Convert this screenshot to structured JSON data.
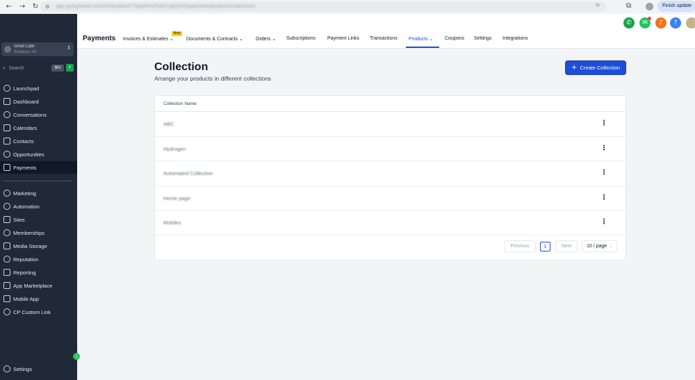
{
  "browser": {
    "url": "app.gohighlevel.com/v2/location/C7qIaeKm2hqEmvgQoD2/payments/products/collections",
    "finish_update": "Finish update"
  },
  "sidebar": {
    "account_name": "Small Cafe",
    "account_sub": "Bengaluru, KA",
    "search_placeholder": "Search",
    "search_shortcut": "⌘K",
    "items": [
      {
        "label": "Launchpad"
      },
      {
        "label": "Dashboard"
      },
      {
        "label": "Conversations"
      },
      {
        "label": "Calendars"
      },
      {
        "label": "Contacts"
      },
      {
        "label": "Opportunities"
      },
      {
        "label": "Payments"
      },
      {
        "label": "Marketing"
      },
      {
        "label": "Automation"
      },
      {
        "label": "Sites"
      },
      {
        "label": "Memberships"
      },
      {
        "label": "Media Storage"
      },
      {
        "label": "Reputation"
      },
      {
        "label": "Reporting"
      },
      {
        "label": "App Marketplace"
      },
      {
        "label": "Mobile App"
      },
      {
        "label": "CP Custom Link"
      }
    ],
    "settings": "Settings"
  },
  "header": {
    "title": "Payments",
    "new_badge": "New",
    "tabs": [
      {
        "label": "Invoices & Estimates ⌄"
      },
      {
        "label": "Documents & Contracts ⌄"
      },
      {
        "label": "Orders ⌄"
      },
      {
        "label": "Subscriptions"
      },
      {
        "label": "Payment Links"
      },
      {
        "label": "Transactions"
      },
      {
        "label": "Products ⌄"
      },
      {
        "label": "Coupons"
      },
      {
        "label": "Settings"
      },
      {
        "label": "Integrations"
      }
    ],
    "active_tab": "Products",
    "icon_colors": {
      "phone": "#16a34a",
      "megaphone": "#22c55e",
      "bell": "#f97316",
      "help": "#3b82f6"
    }
  },
  "main": {
    "title": "Collection",
    "subtitle": "Arrange your products in different collections",
    "create_button": "Create Collection",
    "column_header": "Collection Name",
    "rows": [
      {
        "name": "ABC"
      },
      {
        "name": "Hydrogen"
      },
      {
        "name": "Automated Collection"
      },
      {
        "name": "Home page"
      },
      {
        "name": "Mobiles"
      }
    ],
    "pagination": {
      "previous": "Previous",
      "page": "1",
      "next": "Next",
      "page_size": "10 / page"
    }
  }
}
